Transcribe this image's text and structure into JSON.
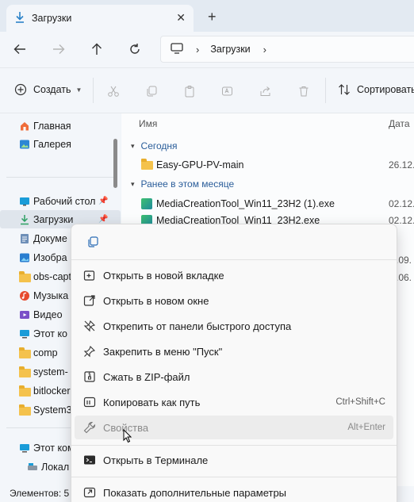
{
  "tab": {
    "title": "Загрузки",
    "close": "✕",
    "new_tab": "+"
  },
  "address": {
    "crumb": "Загрузки",
    "sep": "›",
    "sep2": "›"
  },
  "commandbar": {
    "create_label": "Создать",
    "sort_label": "Сортировать"
  },
  "sidebar": {
    "items": [
      {
        "label": "Главная"
      },
      {
        "label": "Галерея"
      },
      {
        "label": "Рабочий стол"
      },
      {
        "label": "Загрузки"
      },
      {
        "label": "Докуме"
      },
      {
        "label": "Изобра"
      },
      {
        "label": "obs-capt"
      },
      {
        "label": "Музыка"
      },
      {
        "label": "Видео"
      },
      {
        "label": "Этот ко"
      },
      {
        "label": "comp"
      },
      {
        "label": "system-"
      },
      {
        "label": "bitlocker"
      },
      {
        "label": "System3"
      },
      {
        "label": "Этот ком"
      },
      {
        "label": "Локал"
      }
    ]
  },
  "main": {
    "col_name": "Имя",
    "col_date": "Дата",
    "groups": [
      {
        "label": "Сегодня"
      },
      {
        "label": "Ранее в этом месяце"
      }
    ],
    "files": [
      {
        "name": "Easy-GPU-PV-main",
        "date": "26.12."
      },
      {
        "name": "MediaCreationTool_Win11_23H2 (1).exe",
        "date": "02.12."
      },
      {
        "name": "MediaCreationTool_Win11_23H2.exe",
        "date": "02.12."
      }
    ],
    "partial_dates": [
      ".09.",
      ".06."
    ]
  },
  "status": {
    "text": "Элементов: 5"
  },
  "context_menu": {
    "items": [
      {
        "label": "Открыть в новой вкладке",
        "shortcut": ""
      },
      {
        "label": "Открыть в новом окне",
        "shortcut": ""
      },
      {
        "label": "Открепить от панели быстрого доступа",
        "shortcut": ""
      },
      {
        "label": "Закрепить в меню \"Пуск\"",
        "shortcut": ""
      },
      {
        "label": "Сжать в ZIP-файл",
        "shortcut": ""
      },
      {
        "label": "Копировать как путь",
        "shortcut": "Ctrl+Shift+C"
      },
      {
        "label": "Свойства",
        "shortcut": "Alt+Enter"
      },
      {
        "label": "Открыть в Терминале",
        "shortcut": ""
      },
      {
        "label": "Показать дополнительные параметры",
        "shortcut": ""
      }
    ]
  },
  "colors": {
    "accent": "#2a5d9a",
    "folder": "#f4c24c",
    "menu_hover": "#ececec"
  }
}
